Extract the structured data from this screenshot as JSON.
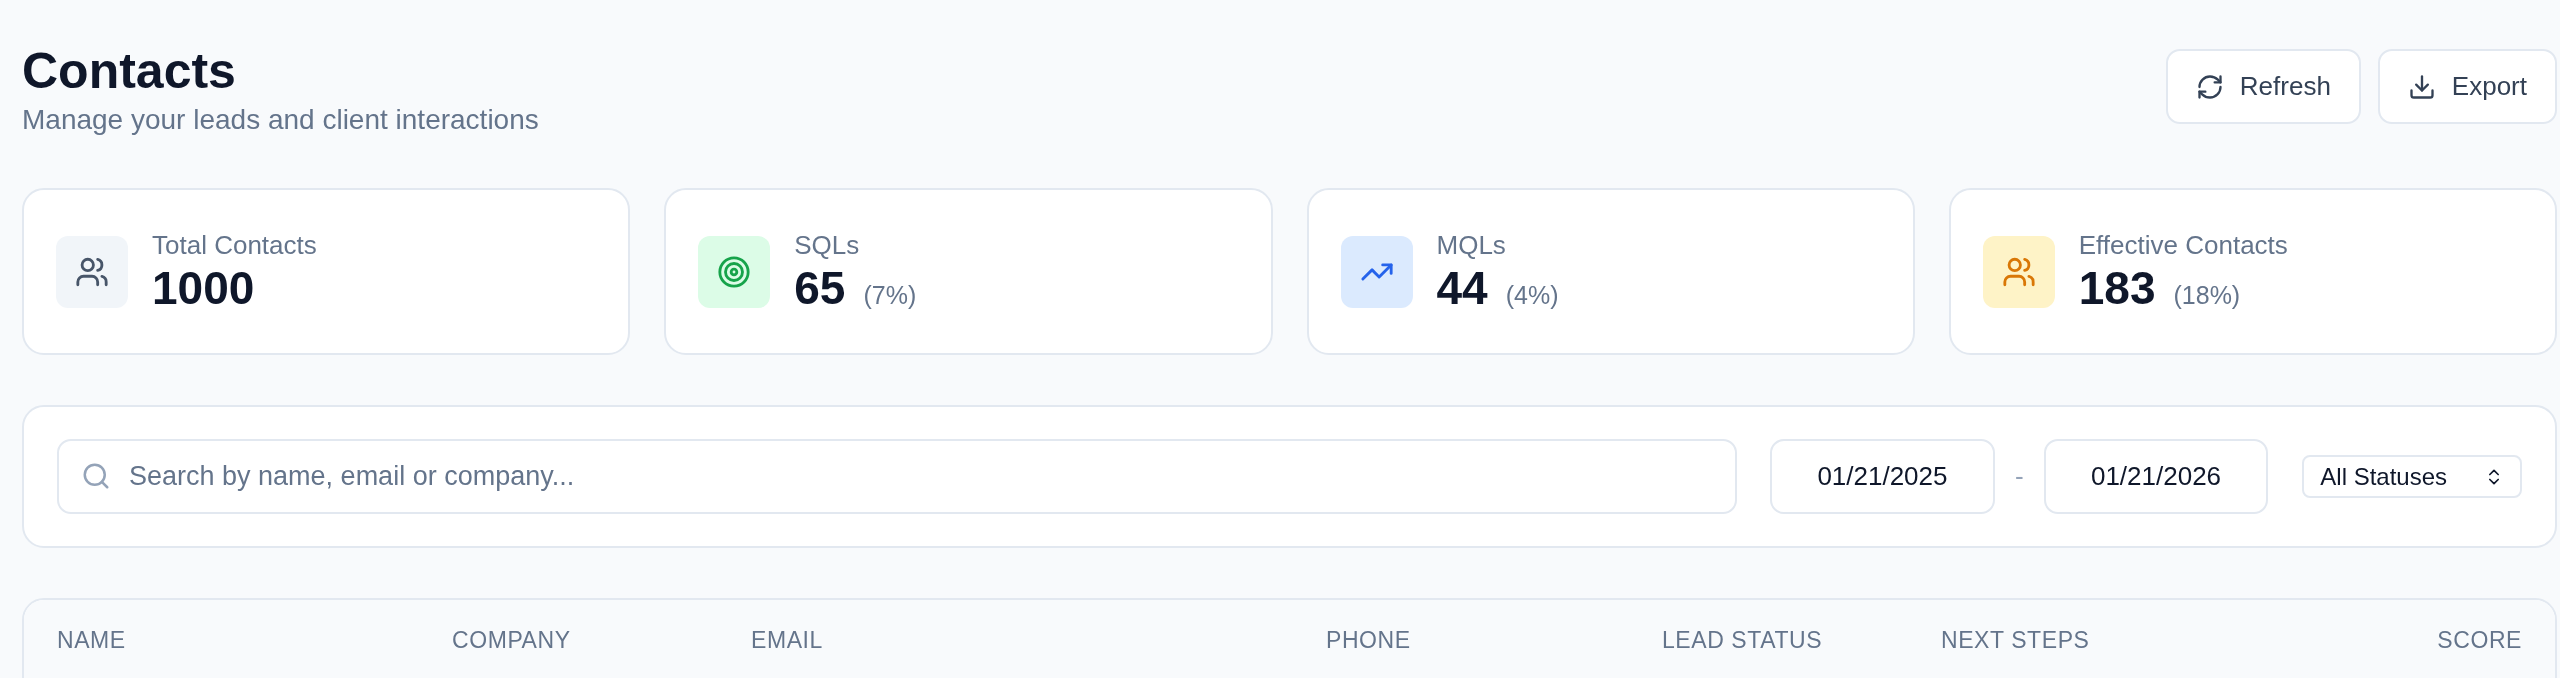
{
  "header": {
    "title": "Contacts",
    "subtitle": "Manage your leads and client interactions"
  },
  "actions": [
    {
      "kind": "refresh",
      "label": "Refresh"
    },
    {
      "kind": "export",
      "label": "Export"
    }
  ],
  "stats": [
    {
      "kind": "users",
      "label": "Total Contacts",
      "value": "1000",
      "color": "#475569"
    },
    {
      "kind": "target",
      "label": "SQLs",
      "value": "65",
      "share": "(7%)",
      "color": "#16a34a"
    },
    {
      "kind": "trend",
      "label": "MQLs",
      "value": "44",
      "share": "(4%)",
      "color": "#2563eb"
    },
    {
      "kind": "users",
      "label": "Effective Contacts",
      "value": "183",
      "share": "(18%)",
      "color": "#d97706"
    }
  ],
  "filters": {
    "search": {
      "placeholder": "Search by name, email or company..."
    },
    "date_from": "01/21/2025",
    "separator": "-",
    "date_to": "01/21/2026",
    "status": "All Statuses"
  },
  "table": {
    "columns": [
      "NAME",
      "COMPANY",
      "EMAIL",
      "PHONE",
      "LEAD STATUS",
      "NEXT STEPS",
      "SCORE"
    ]
  }
}
